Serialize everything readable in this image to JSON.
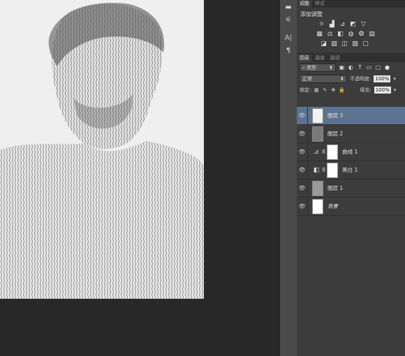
{
  "toolstrip": {
    "text_tool_label": "A|",
    "para_tool_label": "¶"
  },
  "adjustments": {
    "tabs": [
      "调整",
      "样式"
    ],
    "title": "添加调整",
    "row1_icons": [
      "brightness-icon",
      "levels-icon",
      "curves-icon",
      "exposure-icon",
      "vibrance-icon"
    ],
    "row2_icons": [
      "hue-saturation-icon",
      "color-balance-icon",
      "black-white-icon",
      "photo-filter-icon",
      "channel-mixer-icon",
      "color-lookup-icon"
    ],
    "row3_icons": [
      "invert-icon",
      "posterize-icon",
      "threshold-icon",
      "gradient-map-icon",
      "selective-color-icon"
    ]
  },
  "layers_panel": {
    "tabs": [
      "图层",
      "通道",
      "路径"
    ],
    "filter_kind": "类型",
    "blend_mode": "正常",
    "opacity_label": "不透明度:",
    "opacity_value": "100%",
    "lock_label": "锁定:",
    "fill_label": "填充:",
    "fill_value": "100%",
    "layers": [
      {
        "name": "图层 3",
        "selected": true
      },
      {
        "name": "图层 2"
      },
      {
        "name": "曲线 1"
      },
      {
        "name": "黑白 1"
      },
      {
        "name": "图层 1"
      },
      {
        "name": "背景"
      }
    ]
  },
  "colors": {
    "selection": "#5b7290",
    "panel_bg": "#3c3c3c",
    "canvas_bg": "#282828"
  }
}
